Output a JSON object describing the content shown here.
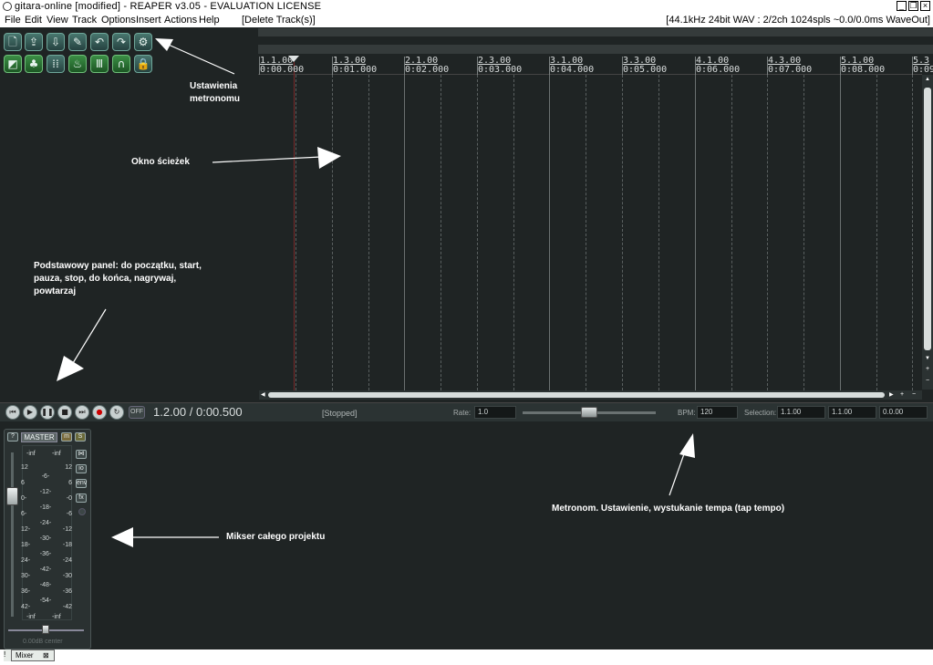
{
  "titlebar": {
    "title": "gitara-online [modified] - REAPER v3.05 - EVALUATION LICENSE",
    "minimize": "_",
    "restore": "❐",
    "close": "×"
  },
  "menubar": {
    "items": [
      "File",
      "Edit",
      "View",
      "Track",
      "Options",
      "Insert",
      "Actions",
      "Help"
    ],
    "last_action": "[Delete Track(s)]",
    "audio_status": "[44.1kHz 24bit WAV : 2/2ch 1024spls ~0.0/0.0ms WaveOut]"
  },
  "toolbar": {
    "row1_icons": [
      "new-project-icon",
      "open-project-icon",
      "save-project-icon",
      "project-settings-icon",
      "undo-icon",
      "redo-icon",
      "metronome-settings-icon"
    ],
    "row2_icons": [
      "snap-icon",
      "ripple-edit-icon",
      "grid-icon",
      "envelope-icon",
      "mixer-icon",
      "loop-icon",
      "lock-icon"
    ]
  },
  "annotations": {
    "metronome_settings": [
      "Ustawienia",
      "metronomu"
    ],
    "tracks_window": "Okno ścieżek",
    "basic_panel": [
      "Podstawowy panel: do początku, start,",
      "pauza, stop, do końca, nagrywaj,",
      "powtarzaj"
    ],
    "metronome_tempo": "Metronom. Ustawienie, wystukanie tempa (tap tempo)",
    "project_mixer": "Mikser całego projektu"
  },
  "ruler": {
    "markers": [
      {
        "bar": "1.1.00",
        "time": "0:00.000"
      },
      {
        "bar": "1.3.00",
        "time": "0:01.000"
      },
      {
        "bar": "2.1.00",
        "time": "0:02.000"
      },
      {
        "bar": "2.3.00",
        "time": "0:03.000"
      },
      {
        "bar": "3.1.00",
        "time": "0:04.000"
      },
      {
        "bar": "3.3.00",
        "time": "0:05.000"
      },
      {
        "bar": "4.1.00",
        "time": "0:06.000"
      },
      {
        "bar": "4.3.00",
        "time": "0:07.000"
      },
      {
        "bar": "5.1.00",
        "time": "0:08.000"
      },
      {
        "bar": "5.3",
        "time": "0:09"
      }
    ]
  },
  "transport": {
    "buttons": [
      "go-to-start-icon",
      "play-icon",
      "pause-icon",
      "stop-icon",
      "go-to-end-icon",
      "record-icon",
      "repeat-icon"
    ],
    "off_label": "OFF",
    "position": "1.2.00 / 0:00.500",
    "status": "[Stopped]",
    "rate_label": "Rate:",
    "rate_value": "1.0",
    "bpm_label": "BPM:",
    "bpm_value": "120",
    "selection_label": "Selection:",
    "selection_start": "1.1.00",
    "selection_end": "1.1.00",
    "selection_length": "0.0.00",
    "rate_slider_level": 0.5
  },
  "mixer": {
    "help_btn": "?",
    "master_label": "MASTER",
    "m_btn": "m",
    "s_btn": "S",
    "peak_left": "-inf",
    "peak_right": "-inf",
    "left_scale": [
      "12",
      "6",
      "0-",
      "6-",
      "12-",
      "18-",
      "24-",
      "30-",
      "36-",
      "42-"
    ],
    "mid_scale": [
      "-6-",
      "-12-",
      "-18-",
      "-24-",
      "-30-",
      "-36-",
      "-42-",
      "-48-",
      "-54-"
    ],
    "right_scale": [
      "12",
      "6",
      "-0",
      "-6",
      "-12",
      "-18",
      "-24",
      "-30",
      "-36",
      "-42"
    ],
    "io_btn": "io",
    "env_btn": "env",
    "fx_btn": "fx",
    "bottom_left": "-inf",
    "bottom_right": "-inf",
    "pan_label": "0.00dB center",
    "tab_label": "Mixer",
    "tab_close": "⊠"
  }
}
